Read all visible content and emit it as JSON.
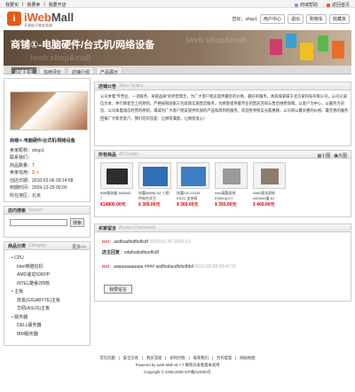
{
  "topbar": {
    "links": [
      "我要买",
      "我要卖",
      "我要开店"
    ],
    "favorites": "商城帮助",
    "home": "返回首页"
  },
  "logo": {
    "mark": "i",
    "name_a": "iWeb",
    "name_b": "Mall",
    "tagline": "开源电子商务系统"
  },
  "userbar": {
    "greeting": "您好，shop1",
    "buttons": [
      "用户中心",
      "退出",
      "购物车",
      "收藏夹"
    ]
  },
  "banner": {
    "title": "商铺①-电脑硬件/台式机/网络设备",
    "watermark": "iweb shop&mall"
  },
  "nav": {
    "tabs": [
      "店铺首页",
      "信用评价",
      "店铺介绍",
      "产品展示"
    ]
  },
  "shop_info": {
    "title": "商铺①-电脑硬件/台式机/网络设备",
    "rows": [
      {
        "k": "卖家昵称：",
        "v": "shop1"
      },
      {
        "k": "联系我们：",
        "v": ""
      },
      {
        "k": "商品数量：",
        "v": "7"
      },
      {
        "k": "卖家信用：",
        "v": "3"
      },
      {
        "k": "创店日期：",
        "v": "2010-02-06 09:14:58"
      },
      {
        "k": "到期时间：",
        "v": "2009-12-25 00:00"
      },
      {
        "k": "所在地区：",
        "v": "北京"
      }
    ]
  },
  "search": {
    "title": "店内搜索",
    "title_en": "Search",
    "button": "搜索"
  },
  "category": {
    "title": "商品分类",
    "title_en": "Category",
    "more": "更多>>",
    "items": [
      {
        "label": "• CPU",
        "level": 1
      },
      {
        "label": "Intel英酷挖机",
        "level": 2
      },
      {
        "label": "AMD速龙5000平",
        "level": 2
      },
      {
        "label": "INTEL酷睿2四核",
        "level": 2
      },
      {
        "label": "• 主板",
        "level": 1
      },
      {
        "label": "技嘉(GIGABYTE)主板",
        "level": 2
      },
      {
        "label": "华硕(ASUS)主板",
        "level": 2
      },
      {
        "label": "• 服务器",
        "level": 1
      },
      {
        "label": "DELL服务器",
        "level": 2
      },
      {
        "label": "IBM服务器",
        "level": 2
      }
    ]
  },
  "notice": {
    "title": "店铺公告",
    "title_en": "Store Notice",
    "text": "公司本着“专营业、一流服务、卓越品质”的经营理念，为广大客户朋友提供最优的价格、最好的服务。本商城隶属于北京某科技有限公司，公司以诚信为本，奉行顾客至上的原则，严格按照国家三包政策实施售后服务，为顾客提供最专业的售前咨询与售后维修保障。以客户为中心、以服务为宗旨，公司本着诚信经营的原则，竭诚为广大客户朋友提供优质的产品和周到的服务。欢迎各界朋友光临惠顾，公司将以最优惠的价格、最完善的服务回报广大新老客户。我们的宗旨是：让顾客满意，让顾客放心！"
  },
  "goods": {
    "title": "所有商品",
    "title_en": "All Goods",
    "view_small": "小图",
    "view_large": "大图",
    "items": [
      {
        "name": "IBM服务器 3650M2 7",
        "price": "¥14800.00元"
      },
      {
        "name": "技嘉M68M-S2 三相供电台式主",
        "price": "¥ 305.00元"
      },
      {
        "name": "技嘉GA-G31M-ES2C 支持双",
        "price": "¥ 369.00元"
      },
      {
        "name": "Intel英酷双核E5300(LGT",
        "price": "¥ 355.00元"
      },
      {
        "name": "AMD速龙双核AD5000盒 64",
        "price": "¥ 400.00元"
      }
    ]
  },
  "messages": {
    "title": "买家留言",
    "title_en": "Buyers Comments",
    "list": [
      {
        "name": "test",
        "text": "：asdfsadfsdfsdfsdf",
        "date": "2010-01-26 10:05:13"
      },
      {
        "name": "店主回复",
        "text": "：sdafsafsdfasdfsdf",
        "date": ""
      },
      {
        "name": "test",
        "text": "：aaaaaaaaaaaa #### asdfsafasdfsfsdfdsf",
        "date": "2010-02-08 09:47:16"
      }
    ],
    "button": "我要留言"
  },
  "footer": {
    "links": [
      "常见问题",
      "安全交易",
      "购买流程",
      "如何付款",
      "联系我们",
      "合作提案",
      "网站地图"
    ],
    "powered": "Powered by iweb Mall v0.7.7 教育开发者版本试用",
    "copyright": "Copyright © 2005-2009 ICP备010000号"
  },
  "colors": {
    "brand": "#e45b17",
    "price": "#dd0000",
    "banner_dark": "#5d4a38"
  }
}
